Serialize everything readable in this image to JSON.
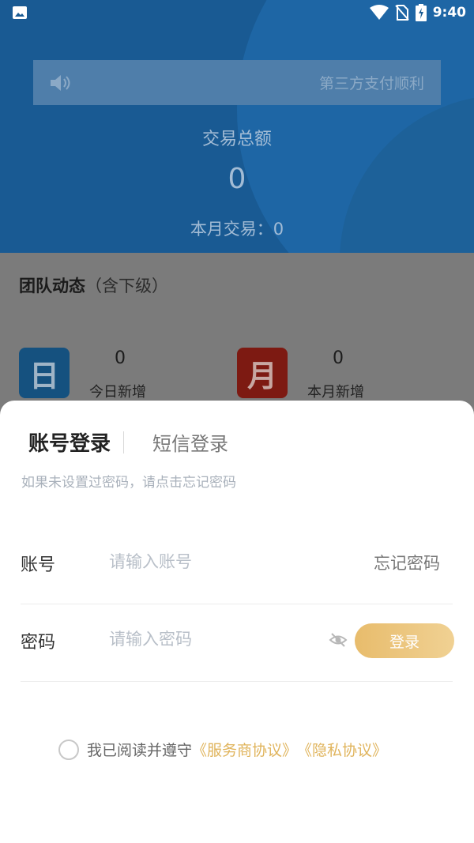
{
  "status_bar": {
    "time": "9:40"
  },
  "background": {
    "notice": "第三方支付顺利",
    "total_title": "交易总额",
    "total_value": "0",
    "month_label": "本月交易：0",
    "team_title": "团队动态",
    "team_subtitle": "（含下级）",
    "stats": [
      {
        "tile": "日",
        "value": "0",
        "caption": "今日新增"
      },
      {
        "tile": "月",
        "value": "0",
        "caption": "本月新增"
      }
    ]
  },
  "login": {
    "tab_account": "账号登录",
    "tab_sms": "短信登录",
    "hint": "如果未设置过密码，请点击忘记密码",
    "account_label": "账号",
    "account_placeholder": "请输入账号",
    "forgot_password": "忘记密码",
    "password_label": "密码",
    "password_placeholder": "请输入密码",
    "login_button": "登录",
    "agree_text": "我已阅读并遵守",
    "service_agreement": "《服务商协议》",
    "privacy_agreement": "《隐私协议》"
  },
  "colors": {
    "primary": "#195a93",
    "accent": "#e8bc6c"
  }
}
